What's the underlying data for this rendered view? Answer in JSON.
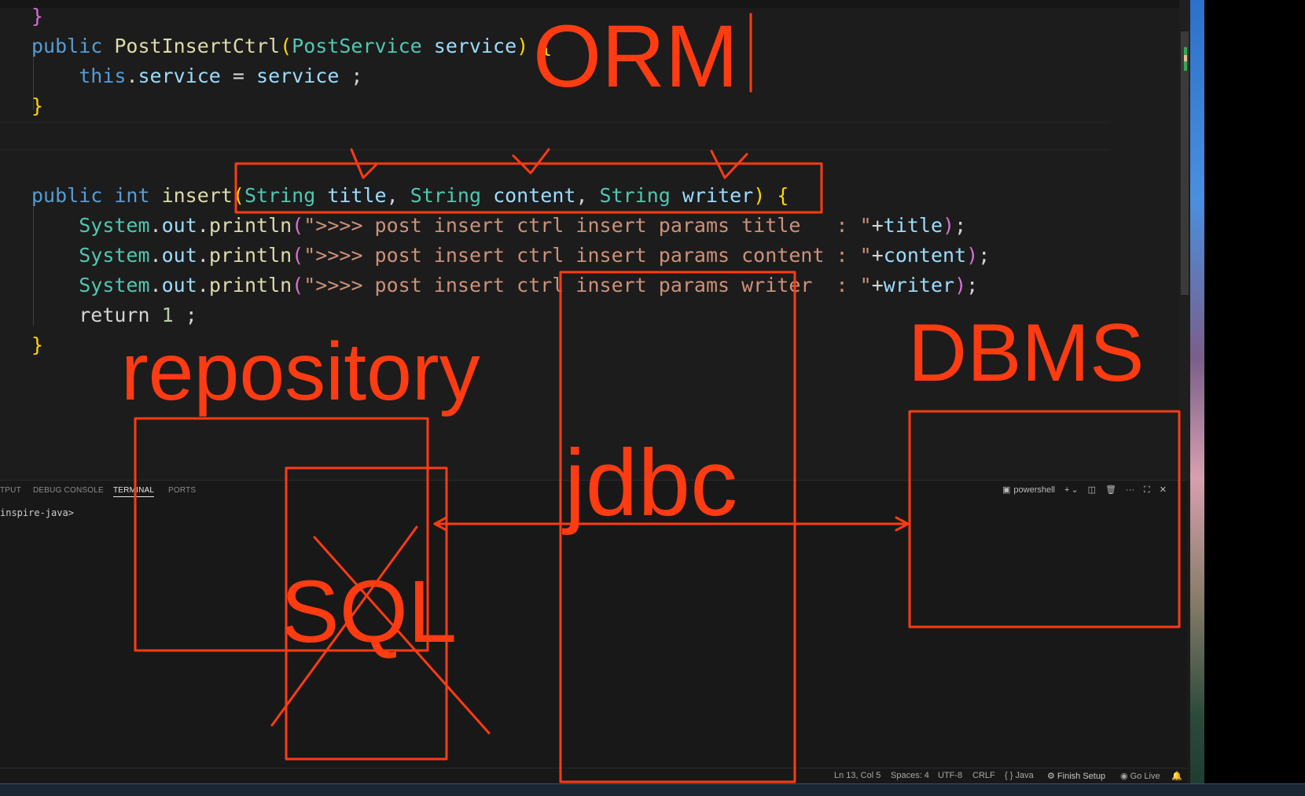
{
  "editor": {
    "lines": [
      [
        {
          "t": "}",
          "c": "br1"
        }
      ],
      [
        {
          "t": "public ",
          "c": "kw"
        },
        {
          "t": "PostInsertCtrl",
          "c": "fn"
        },
        {
          "t": "(",
          "c": "br2"
        },
        {
          "t": "PostService",
          "c": "ty"
        },
        {
          "t": " ",
          "c": "tx"
        },
        {
          "t": "service",
          "c": "var"
        },
        {
          "t": ")",
          "c": "br2"
        },
        {
          "t": " {",
          "c": "br2"
        }
      ],
      [
        {
          "t": "    ",
          "c": "tx"
        },
        {
          "t": "this",
          "c": "kw"
        },
        {
          "t": ".",
          "c": "tx"
        },
        {
          "t": "service",
          "c": "var"
        },
        {
          "t": " = ",
          "c": "tx"
        },
        {
          "t": "service",
          "c": "var"
        },
        {
          "t": " ;",
          "c": "tx"
        }
      ],
      [
        {
          "t": "}",
          "c": "br2"
        }
      ],
      [],
      [],
      [
        {
          "t": "public ",
          "c": "kw"
        },
        {
          "t": "int ",
          "c": "kw"
        },
        {
          "t": "insert",
          "c": "fn"
        },
        {
          "t": "(",
          "c": "br2"
        },
        {
          "t": "String",
          "c": "ty"
        },
        {
          "t": " ",
          "c": "tx"
        },
        {
          "t": "title",
          "c": "var"
        },
        {
          "t": ", ",
          "c": "tx"
        },
        {
          "t": "String",
          "c": "ty"
        },
        {
          "t": " ",
          "c": "tx"
        },
        {
          "t": "content",
          "c": "var"
        },
        {
          "t": ", ",
          "c": "tx"
        },
        {
          "t": "String",
          "c": "ty"
        },
        {
          "t": " ",
          "c": "tx"
        },
        {
          "t": "writer",
          "c": "var"
        },
        {
          "t": ")",
          "c": "br2"
        },
        {
          "t": " {",
          "c": "br2"
        }
      ],
      [
        {
          "t": "    ",
          "c": "tx"
        },
        {
          "t": "System",
          "c": "ty"
        },
        {
          "t": ".",
          "c": "tx"
        },
        {
          "t": "out",
          "c": "var"
        },
        {
          "t": ".",
          "c": "tx"
        },
        {
          "t": "println",
          "c": "fn"
        },
        {
          "t": "(",
          "c": "br1"
        },
        {
          "t": "\">>>> post insert ctrl insert params title   : \"",
          "c": "str"
        },
        {
          "t": "+",
          "c": "tx"
        },
        {
          "t": "title",
          "c": "var"
        },
        {
          "t": ")",
          "c": "br1"
        },
        {
          "t": ";",
          "c": "tx"
        }
      ],
      [
        {
          "t": "    ",
          "c": "tx"
        },
        {
          "t": "System",
          "c": "ty"
        },
        {
          "t": ".",
          "c": "tx"
        },
        {
          "t": "out",
          "c": "var"
        },
        {
          "t": ".",
          "c": "tx"
        },
        {
          "t": "println",
          "c": "fn"
        },
        {
          "t": "(",
          "c": "br1"
        },
        {
          "t": "\">>>> post insert ctrl insert params content : \"",
          "c": "str"
        },
        {
          "t": "+",
          "c": "tx"
        },
        {
          "t": "content",
          "c": "var"
        },
        {
          "t": ")",
          "c": "br1"
        },
        {
          "t": ";",
          "c": "tx"
        }
      ],
      [
        {
          "t": "    ",
          "c": "tx"
        },
        {
          "t": "System",
          "c": "ty"
        },
        {
          "t": ".",
          "c": "tx"
        },
        {
          "t": "out",
          "c": "var"
        },
        {
          "t": ".",
          "c": "tx"
        },
        {
          "t": "println",
          "c": "fn"
        },
        {
          "t": "(",
          "c": "br1"
        },
        {
          "t": "\">>>> post insert ctrl insert params writer  : \"",
          "c": "str"
        },
        {
          "t": "+",
          "c": "tx"
        },
        {
          "t": "writer",
          "c": "var"
        },
        {
          "t": ")",
          "c": "br1"
        },
        {
          "t": ";",
          "c": "tx"
        }
      ],
      [
        {
          "t": "    ",
          "c": "tx"
        },
        {
          "t": "return ",
          "c": "tx"
        },
        {
          "t": "1",
          "c": "num"
        },
        {
          "t": " ;",
          "c": "tx"
        }
      ],
      [
        {
          "t": "}",
          "c": "br2"
        }
      ]
    ]
  },
  "annotations": {
    "orm": "ORM",
    "dbms": "DBMS",
    "repository": "repository",
    "jdbc": "jdbc",
    "sql": "SQL",
    "color": "#ff3b12"
  },
  "panel": {
    "tabs": {
      "output": "TPUT",
      "debug_console": "DEBUG CONSOLE",
      "terminal": "TERMINAL",
      "ports": "PORTS"
    },
    "terminal_prompt": "inspire-java>",
    "shell_label": "powershell",
    "add_icon": "+",
    "chevron_icon": "⌄",
    "split_icon": "◫",
    "trash_icon": "🗑",
    "more_icon": "···",
    "maximize_icon": "⛶",
    "close_icon": "✕"
  },
  "statusbar": {
    "position": "Ln 13, Col 5",
    "spaces": "Spaces: 4",
    "encoding": "UTF-8",
    "eol": "CRLF",
    "language": "{ } Java",
    "finish_setup": "Finish Setup",
    "go_live": "Go Live",
    "bell_icon": "🔔"
  }
}
